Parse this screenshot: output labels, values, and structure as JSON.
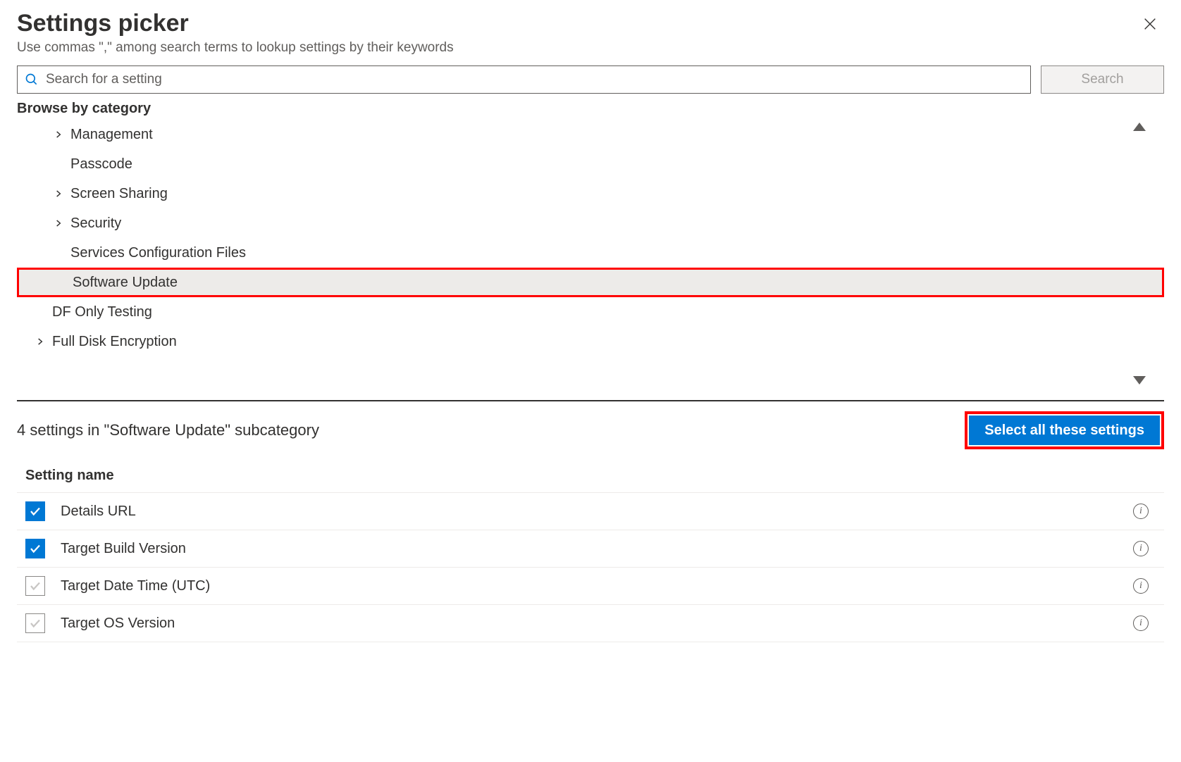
{
  "header": {
    "title": "Settings picker",
    "subtitle": "Use commas \",\" among search terms to lookup settings by their keywords"
  },
  "search": {
    "placeholder": "Search for a setting",
    "button_label": "Search"
  },
  "browse": {
    "label": "Browse by category",
    "categories": [
      {
        "label": "Management",
        "expandable": true,
        "indent": 1,
        "selected": false
      },
      {
        "label": "Passcode",
        "expandable": false,
        "indent": 1,
        "selected": false
      },
      {
        "label": "Screen Sharing",
        "expandable": true,
        "indent": 1,
        "selected": false
      },
      {
        "label": "Security",
        "expandable": true,
        "indent": 1,
        "selected": false
      },
      {
        "label": "Services Configuration Files",
        "expandable": false,
        "indent": 1,
        "selected": false
      },
      {
        "label": "Software Update",
        "expandable": false,
        "indent": 1,
        "selected": true
      },
      {
        "label": "DF Only Testing",
        "expandable": false,
        "indent": 0,
        "selected": false
      },
      {
        "label": "Full Disk Encryption",
        "expandable": true,
        "indent": 0,
        "selected": false
      }
    ]
  },
  "settings_panel": {
    "count_text": "4 settings in \"Software Update\" subcategory",
    "select_all_label": "Select all these settings",
    "column_header": "Setting name",
    "rows": [
      {
        "label": "Details URL",
        "checked": true
      },
      {
        "label": "Target Build Version",
        "checked": true
      },
      {
        "label": "Target Date Time (UTC)",
        "checked": false
      },
      {
        "label": "Target OS Version",
        "checked": false
      }
    ]
  }
}
